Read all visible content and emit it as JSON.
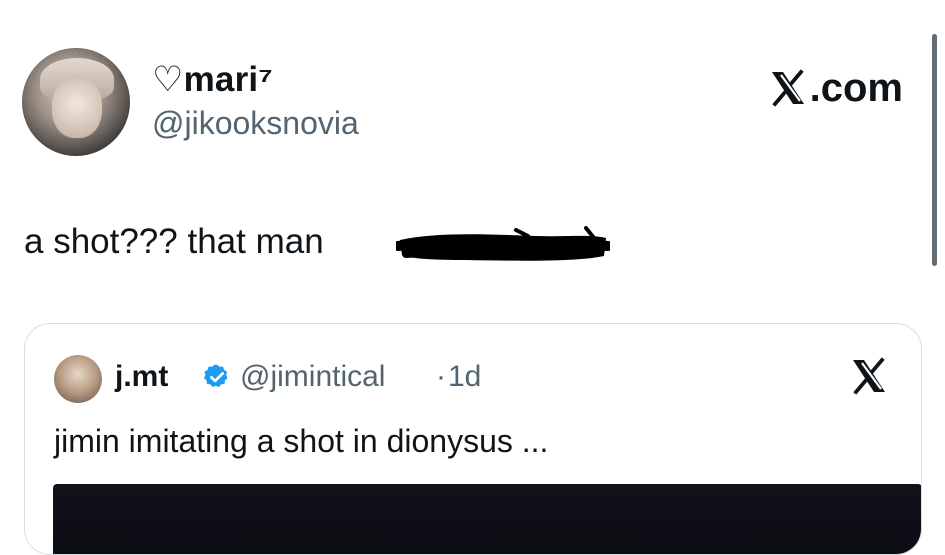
{
  "author": {
    "display_name": "♡mari⁷",
    "handle": "@jikooksnovia"
  },
  "brand": {
    "text": ".com",
    "icon": "x-logo-icon"
  },
  "tweet": {
    "text": "a shot??? that man"
  },
  "quoted": {
    "name": "j.mt",
    "handle": "@jimintical",
    "separator": "·",
    "time": "1d",
    "text": "jimin imitating a shot in dionysus ...",
    "verified_icon": "verified-badge-icon",
    "close_icon": "x-logo-icon"
  },
  "colors": {
    "text": "#0f1419",
    "secondary": "#536471",
    "verified": "#1d9bf0",
    "border": "#d9dee2"
  }
}
